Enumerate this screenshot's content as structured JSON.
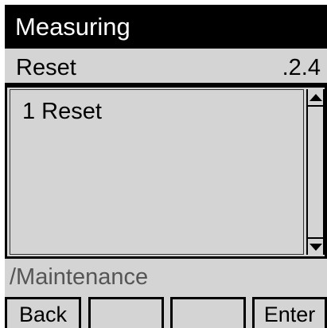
{
  "title": "Measuring",
  "menu": {
    "name": "Reset",
    "code": ".2.4"
  },
  "list": {
    "items": [
      {
        "label": "1 Reset"
      }
    ]
  },
  "path": "/Maintenance",
  "softkeys": {
    "key1": "Back",
    "key2": "",
    "key3": "",
    "key4": "Enter"
  },
  "colors": {
    "background": "#d4d4d4",
    "title_bar": "#000000",
    "title_text": "#ffffff",
    "path_text": "#555555"
  },
  "icons": {
    "scroll_up": "arrow-up-icon",
    "scroll_down": "arrow-down-icon"
  }
}
